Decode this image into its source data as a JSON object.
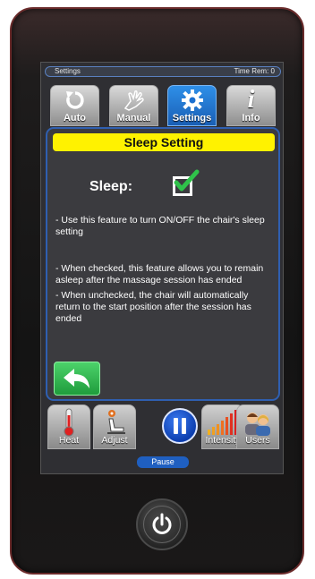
{
  "status_bar": {
    "screen_name": "Settings",
    "time_remaining": "Time Rem: 0"
  },
  "tabs": [
    {
      "label": "Auto",
      "icon": "refresh-icon"
    },
    {
      "label": "Manual",
      "icon": "hand-icon"
    },
    {
      "label": "Settings",
      "icon": "gear-icon",
      "active": true
    },
    {
      "label": "Info",
      "icon": "info-icon"
    }
  ],
  "panel": {
    "title": "Sleep Setting",
    "sleep_label": "Sleep:",
    "sleep_checked": true,
    "descriptions": [
      "- Use this feature to turn ON/OFF the chair's sleep setting",
      "- When checked, this feature allows you to remain asleep after the massage session has ended",
      "- When unchecked, the chair will automatically return to the start position after the session has ended"
    ]
  },
  "bottom_bar": {
    "heat": "Heat",
    "adjust": "Adjust",
    "intensity": "Intensity",
    "users": "Users",
    "pause": "Pause"
  },
  "colors": {
    "title_bar": "#fff200",
    "active_tab": "#1a6fd0",
    "panel_border": "#2f5fb0",
    "back_button": "#2fb24a",
    "checkmark": "#2fc24a"
  }
}
